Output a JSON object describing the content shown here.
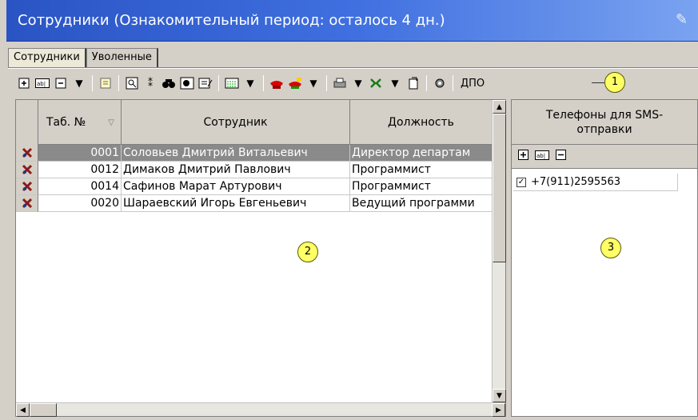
{
  "window": {
    "title": "Сотрудники (Ознакомительный период: осталось 4 дн.)"
  },
  "tabs": [
    {
      "label": "Сотрудники",
      "active": true
    },
    {
      "label": "Уволенные",
      "active": false
    }
  ],
  "toolbar": {
    "dpo_label": "ДПО"
  },
  "callouts": {
    "one": "1",
    "two": "2",
    "three": "3"
  },
  "grid": {
    "columns": [
      "Таб. №",
      "Сотрудник",
      "Должность"
    ],
    "rows": [
      {
        "num": "0001",
        "name": "Соловьев Дмитрий Витальевич",
        "pos": "Директор департам",
        "selected": true
      },
      {
        "num": "0012",
        "name": "Димаков Дмитрий Павлович",
        "pos": "Программист",
        "selected": false
      },
      {
        "num": "0014",
        "name": "Сафинов Марат Артурович",
        "pos": "Программист",
        "selected": false
      },
      {
        "num": "0020",
        "name": "Шараевский Игорь Евгеньевич",
        "pos": "Ведущий программи",
        "selected": false
      }
    ]
  },
  "phones": {
    "header": "Телефоны для SMS-отправки",
    "items": [
      {
        "number": "+7(911)2595563",
        "checked": true
      }
    ]
  },
  "colors": {
    "title_start": "#2a54c4",
    "title_end": "#7aa3f0",
    "selected_row": "#8a8a8a",
    "callout": "#ffff66"
  }
}
